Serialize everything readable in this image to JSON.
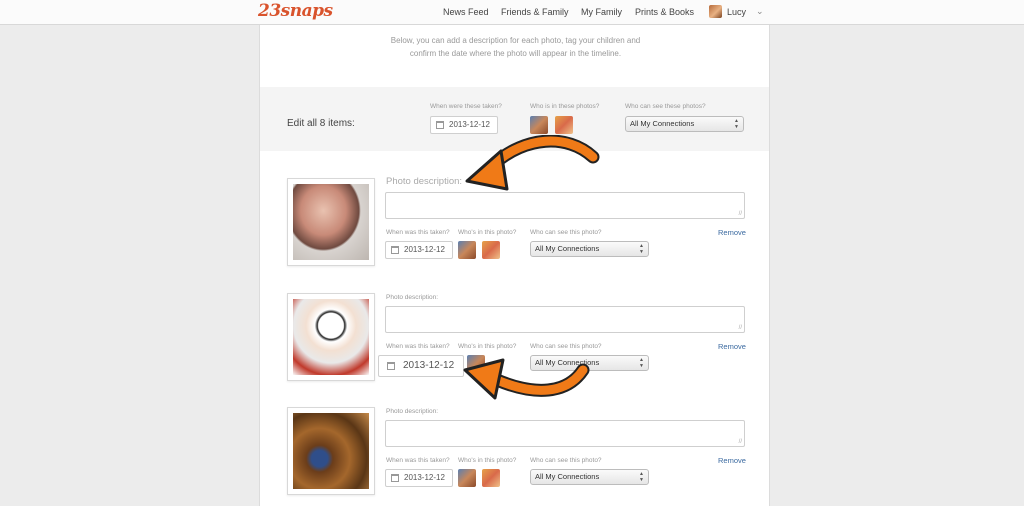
{
  "header": {
    "logo": "23snaps",
    "nav": [
      "News Feed",
      "Friends & Family",
      "My Family",
      "Prints & Books"
    ],
    "user_name": "Lucy"
  },
  "intro": {
    "line1": "Below, you can add a description for each photo, tag your children and",
    "line2": "confirm the date where the photo will appear in the timeline."
  },
  "bulk": {
    "title": "Edit all 8 items:",
    "when_label": "When were these taken?",
    "who_label": "Who is in these photos?",
    "visibility_label": "Who can see these photos?",
    "date": "2013-12-12",
    "visibility": "All My Connections"
  },
  "items": [
    {
      "desc_label": "Photo description:",
      "when_label": "When was this taken?",
      "who_label": "Who's in this photo?",
      "visibility_label": "Who can see this photo?",
      "date": "2013-12-12",
      "visibility": "All My Connections",
      "remove": "Remove"
    },
    {
      "desc_label": "Photo description:",
      "when_label": "When was this taken?",
      "who_label": "Who's in this photo?",
      "visibility_label": "Who can see this photo?",
      "date": "2013-12-12",
      "visibility": "All My Connections",
      "remove": "Remove"
    },
    {
      "desc_label": "Photo description:",
      "when_label": "When was this taken?",
      "who_label": "Who's in this photo?",
      "visibility_label": "Who can see this photo?",
      "date": "2013-12-12",
      "visibility": "All My Connections",
      "remove": "Remove"
    }
  ],
  "colors": {
    "brand": "#d9532c",
    "arrow": "#f07a17",
    "link": "#3b6aa0"
  }
}
